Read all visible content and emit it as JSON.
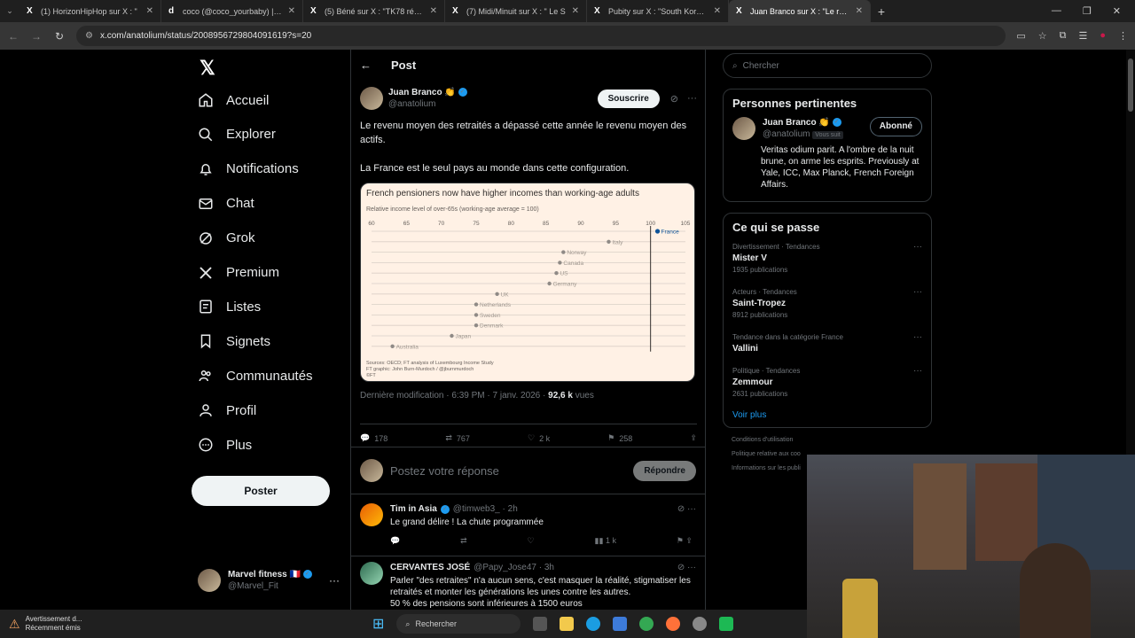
{
  "browser": {
    "tabs": [
      {
        "title": "(1) HorizonHipHop sur X : \"",
        "icon": "X",
        "active": false
      },
      {
        "title": "coco (@coco_yourbaby) | TikTok",
        "icon": "d",
        "active": false
      },
      {
        "title": "(5) Béné sur X : \"TK78 réagit à l",
        "icon": "X",
        "active": false
      },
      {
        "title": "(7) Midi/Minuit sur X : \" Le S",
        "icon": "X",
        "active": false
      },
      {
        "title": "Pubity sur X : \"South Korea's pr",
        "icon": "X",
        "active": false
      },
      {
        "title": "Juan Branco sur X : \"Le reve",
        "icon": "X",
        "active": true
      }
    ],
    "url": "x.com/anatolium/status/2008956729804091619?s=20"
  },
  "nav": {
    "items": [
      {
        "label": "Accueil",
        "icon": "home-icon"
      },
      {
        "label": "Explorer",
        "icon": "search-icon"
      },
      {
        "label": "Notifications",
        "icon": "bell-icon"
      },
      {
        "label": "Chat",
        "icon": "mail-icon"
      },
      {
        "label": "Grok",
        "icon": "grok-icon"
      },
      {
        "label": "Premium",
        "icon": "x-logo-icon"
      },
      {
        "label": "Listes",
        "icon": "list-icon"
      },
      {
        "label": "Signets",
        "icon": "bookmark-icon"
      },
      {
        "label": "Communautés",
        "icon": "people-icon"
      },
      {
        "label": "Profil",
        "icon": "person-icon"
      },
      {
        "label": "Plus",
        "icon": "more-circle-icon"
      }
    ],
    "post_label": "Poster",
    "account": {
      "name": "Marvel fitness 🇫🇷",
      "handle": "@Marvel_Fit"
    }
  },
  "post": {
    "header": "Post",
    "author": {
      "name": "Juan Branco",
      "emoji": "👏",
      "handle": "@anatolium"
    },
    "subscribe_label": "Souscrire",
    "text1": "Le revenu moyen des retraités a dépassé cette année le revenu moyen des actifs.",
    "text2": "La France est le seul pays au monde dans cette configuration.",
    "meta": {
      "prefix": "Dernière modification · 6:39 PM · 7 janv. 2026 · ",
      "views": "92,6 k",
      "views_label": "vues"
    },
    "stats": {
      "replies": "178",
      "reposts": "767",
      "likes": "2 k",
      "bookmarks": "258"
    }
  },
  "chart_data": {
    "type": "scatter",
    "title": "French pensioners now have higher incomes than working-age adults",
    "subtitle": "Relative income level of over-65s (working-age average = 100)",
    "xlim": [
      60,
      105
    ],
    "xticks": [
      60,
      65,
      70,
      75,
      80,
      85,
      90,
      95,
      100,
      105
    ],
    "categories": [
      "France",
      "Italy",
      "Norway",
      "Canada",
      "US",
      "Germany",
      "UK",
      "Netherlands",
      "Sweden",
      "Denmark",
      "Japan",
      "Australia"
    ],
    "values": [
      101,
      94,
      87.5,
      87,
      86.5,
      85.5,
      78,
      75,
      75,
      75,
      71.5,
      63
    ],
    "highlight": "France",
    "reference_line": 100,
    "sources": [
      "Sources: OECD; FT analysis of Luxembourg Income Study",
      "FT graphic: John Burn-Murdoch / @jburnmurdoch",
      "©FT"
    ]
  },
  "reply_box": {
    "placeholder": "Postez votre réponse",
    "button": "Répondre"
  },
  "replies": [
    {
      "name": "Tim in Asia",
      "handle": "@timweb3_ · 2h",
      "text": "Le grand délire ! La chute programmée",
      "views": "1 k"
    },
    {
      "name": "CERVANTES JOSÉ",
      "handle": "@Papy_Jose47 · 3h",
      "text": "Parler \"des retraites\" n'a aucun sens, c'est masquer la réalité, stigmatiser les retraités et monter les générations les unes contre les autres.\n50 % des pensions sont inférieures à 1500 euros",
      "views": ""
    }
  ],
  "sidebar": {
    "search_placeholder": "Chercher",
    "relevant": {
      "title": "Personnes pertinentes",
      "name": "Juan Branco",
      "handle": "@anatolium",
      "follows_you": "Vous suit",
      "button": "Abonné",
      "bio": "Veritas odium parit. A l'ombre de la nuit brune, on arme les esprits. Previously at Yale, ICC, Max Planck, French Foreign Affairs."
    },
    "trends": {
      "title": "Ce qui se passe",
      "items": [
        {
          "category": "Divertissement · Tendances",
          "name": "Mister V",
          "count": "1935 publications"
        },
        {
          "category": "Acteurs · Tendances",
          "name": "Saint-Tropez",
          "count": "8912 publications"
        },
        {
          "category": "Tendance dans la catégorie France",
          "name": "Vallini",
          "count": ""
        },
        {
          "category": "Politique · Tendances",
          "name": "Zemmour",
          "count": "2631 publications"
        }
      ],
      "more": "Voir plus"
    },
    "footer": [
      "Conditions d'utilisation",
      "Politique relative aux coo",
      "Informations sur les publi"
    ]
  },
  "taskbar": {
    "notification_title": "Avertissement d...",
    "notification_sub": "Récemment émis",
    "search": "Rechercher"
  },
  "colors": {
    "accent": "#1d9bf0",
    "background": "#000000",
    "chart_bg": "#fff1e5",
    "france_dot": "#0f5499"
  }
}
